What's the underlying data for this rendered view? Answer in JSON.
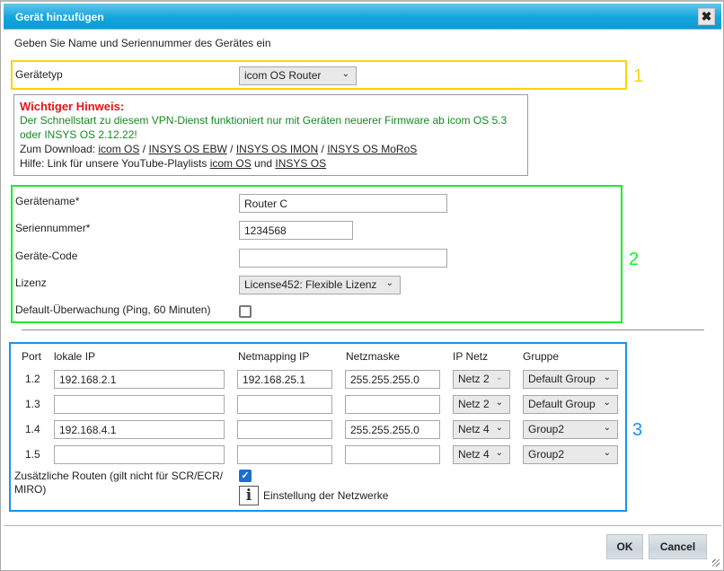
{
  "dialog": {
    "title": "Gerät hinzufügen",
    "close_icon": "✖",
    "intro": "Geben Sie Name und Seriennummer des Gerätes ein"
  },
  "section1": {
    "number": "1",
    "device_type_label": "Gerätetyp",
    "device_type_value": "icom OS Router"
  },
  "notice": {
    "title": "Wichtiger Hinweis:",
    "message": "Der Schnellstart zu diesem VPN-Dienst funktioniert nur mit Geräten neuerer Firmware ab icom OS 5.3 oder INSYS OS 2.12.22!",
    "download_prefix": "Zum Download:",
    "download_links": [
      "icom OS",
      "INSYS OS EBW",
      "INSYS OS IMON",
      "INSYS OS MoRoS"
    ],
    "separator": "/",
    "help_prefix": "Hilfe: Link für unsere YouTube-Playlists",
    "help_links": [
      "icom OS",
      "INSYS OS"
    ],
    "help_conjunction": "und"
  },
  "section2": {
    "number": "2",
    "device_name_label": "Gerätename*",
    "device_name_value": "Router C",
    "serial_label": "Seriennummer*",
    "serial_value": "1234568",
    "device_code_label": "Geräte-Code",
    "device_code_value": "",
    "license_label": "Lizenz",
    "license_value": "License452: Flexible Lizenz",
    "monitoring_label": "Default-Überwachung (Ping, 60 Minuten)",
    "monitoring_checked": false
  },
  "section3": {
    "number": "3",
    "headers": {
      "port": "Port",
      "local_ip": "lokale IP",
      "netmapping_ip": "Netmapping IP",
      "netmask": "Netzmaske",
      "ip_net": "IP Netz",
      "group": "Gruppe"
    },
    "rows": [
      {
        "port": "1.2",
        "local_ip": "192.168.2.1",
        "netmapping_ip": "192.168.25.1",
        "netmask": "255.255.255.0",
        "ip_net": "Netz 2",
        "group": "Default Group"
      },
      {
        "port": "1.3",
        "local_ip": "",
        "netmapping_ip": "",
        "netmask": "",
        "ip_net": "Netz 2",
        "group": "Default Group"
      },
      {
        "port": "1.4",
        "local_ip": "192.168.4.1",
        "netmapping_ip": "",
        "netmask": "255.255.255.0",
        "ip_net": "Netz 4",
        "group": "Group2"
      },
      {
        "port": "1.5",
        "local_ip": "",
        "netmapping_ip": "",
        "netmask": "",
        "ip_net": "Netz 4",
        "group": "Group2"
      }
    ],
    "extra_routes_label": "Zusätzliche Routen (gilt nicht für SCR/ECR/ MIRO)",
    "extra_routes_checked": true,
    "info_icon": "i",
    "network_settings_link": "Einstellung der Netzwerke"
  },
  "footer": {
    "ok_label": "OK",
    "cancel_label": "Cancel"
  },
  "colors": {
    "title_bar": "#14a5dc",
    "section1_border": "#f5d60c",
    "section2_border": "#14f02a",
    "section3_border": "#1593f0",
    "notice_title": "#e3141b",
    "notice_message": "#138a1f",
    "checkbox_checked": "#1a6fd1"
  }
}
